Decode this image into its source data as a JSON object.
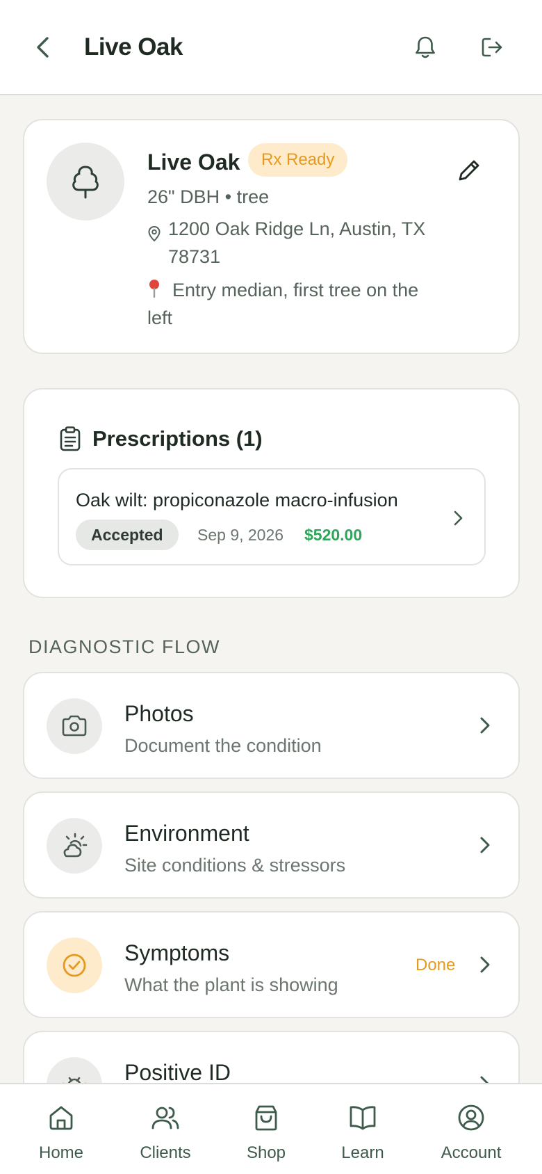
{
  "header": {
    "title": "Live Oak"
  },
  "tree": {
    "name": "Live Oak",
    "badge": "Rx Ready",
    "size": "26\" DBH • tree",
    "address": "1200 Oak Ridge Ln, Austin, TX 78731",
    "location_note": "Entry median, first tree on the left"
  },
  "prescriptions": {
    "title": "Prescriptions (1)",
    "items": [
      {
        "name": "Oak wilt: propiconazole macro-infusion",
        "status": "Accepted",
        "date": "Sep 9, 2026",
        "price": "$520.00"
      }
    ]
  },
  "diagnostic_flow": {
    "section_title": "DIAGNOSTIC FLOW",
    "steps": [
      {
        "title": "Photos",
        "subtitle": "Document the condition",
        "icon": "camera-icon",
        "status": ""
      },
      {
        "title": "Environment",
        "subtitle": "Site conditions & stressors",
        "icon": "weather-icon",
        "status": ""
      },
      {
        "title": "Symptoms",
        "subtitle": "What the plant is showing",
        "icon": "check-circle-icon",
        "status": "Done"
      },
      {
        "title": "Positive ID",
        "subtitle": "",
        "icon": "bug-icon",
        "status": ""
      }
    ]
  },
  "nav": {
    "items": [
      {
        "label": "Home",
        "icon": "home-icon"
      },
      {
        "label": "Clients",
        "icon": "users-icon"
      },
      {
        "label": "Shop",
        "icon": "shopping-bag-icon"
      },
      {
        "label": "Learn",
        "icon": "book-icon"
      },
      {
        "label": "Account",
        "icon": "user-circle-icon"
      }
    ]
  },
  "colors": {
    "brand_green": "#3e5a4a",
    "accent_amber": "#e59a1f",
    "price_green": "#2fa55a",
    "background": "#f5f4f1"
  }
}
